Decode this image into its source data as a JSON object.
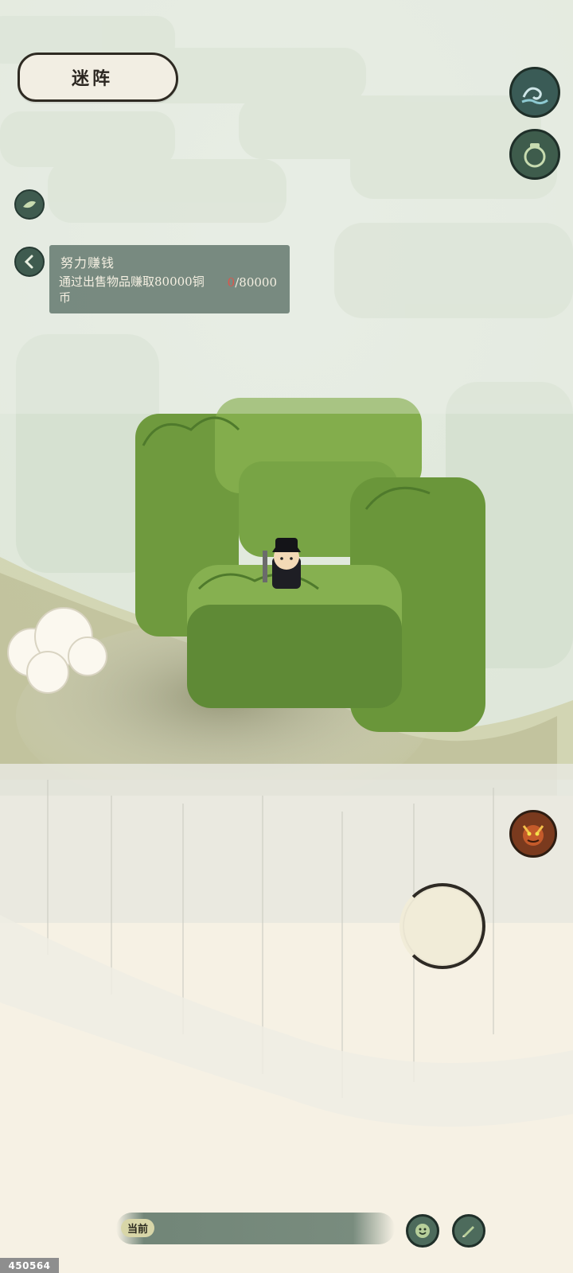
{
  "header": {
    "title": "迷阵"
  },
  "quest": {
    "title": "努力赚钱",
    "description": "通过出售物品赚取80000铜币",
    "progress_current": "0",
    "progress_total": "/80000"
  },
  "bottom_bar": {
    "label": "当前"
  },
  "overlay": {
    "id_badge": "450564"
  },
  "colors": {
    "hedge": "#7fa64a",
    "hedge_dark": "#5f8a36",
    "fog": "#e9efe3",
    "button": "#3d5a4f",
    "panel": "#586e64",
    "progress_red": "#e05349"
  },
  "icons": {
    "top_right_1": "wave-icon",
    "top_right_2": "jar-icon",
    "left_small": "leaf-icon",
    "collapse": "chevron-left-icon",
    "enemy": "demon-face-icon",
    "emote": "smile-icon",
    "draw": "brush-icon"
  }
}
